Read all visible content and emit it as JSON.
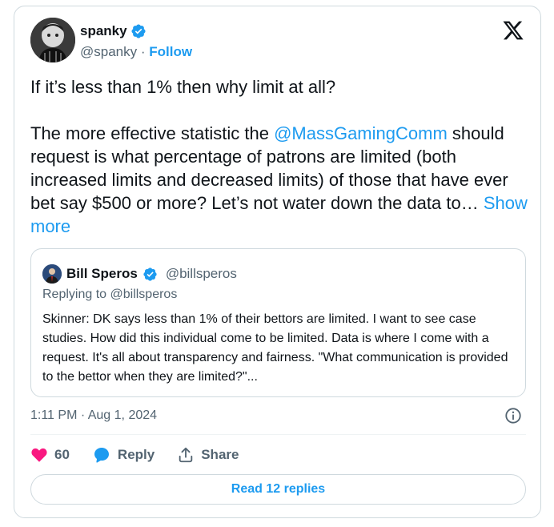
{
  "tweet": {
    "author": {
      "name": "spanky",
      "handle": "@spanky",
      "follow_label": "Follow"
    },
    "paragraph1": "If it’s less than 1% then why limit at all?",
    "paragraph2_before": "The more effective statistic the ",
    "mention": "@MassGamingComm",
    "paragraph2_after": " should request is what percentage of patrons are limited (both increased limits and decreased limits) of those that have ever bet say $500 or more? Let’s not water down the data to…",
    "show_more": "Show more",
    "timestamp": "1:11 PM · Aug 1, 2024",
    "likes": "60",
    "reply_label": "Reply",
    "share_label": "Share",
    "read_replies": "Read 12 replies"
  },
  "quote": {
    "name": "Bill Speros",
    "handle": "@billsperos",
    "replying_to": "Replying to @billsperos",
    "text": "Skinner: DK says less than 1% of their bettors are limited. I want to see case studies. How did this individual come to be limited. Data is where I come with a request. It's all about transparency and fairness. \"What communication is provided to the bettor when they are limited?\"..."
  },
  "colors": {
    "accent": "#1d9bf0",
    "like": "#f91880",
    "muted": "#536471",
    "text": "#0f1419",
    "border": "#cfd9de"
  },
  "icons": [
    "verified-badge-icon",
    "x-logo-icon",
    "info-icon",
    "heart-icon",
    "reply-bubble-icon",
    "share-icon"
  ]
}
